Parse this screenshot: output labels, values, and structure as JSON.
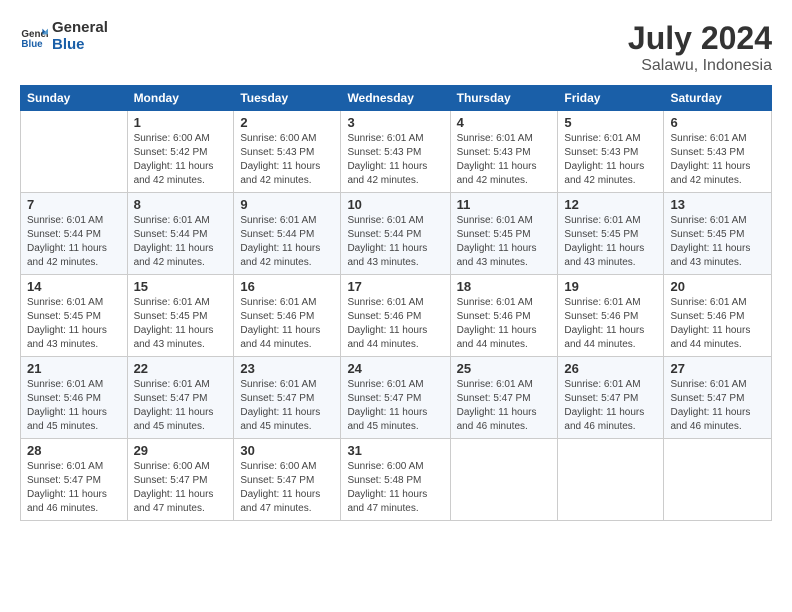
{
  "logo": {
    "line1": "General",
    "line2": "Blue"
  },
  "title": {
    "month_year": "July 2024",
    "location": "Salawu, Indonesia"
  },
  "header": {
    "days": [
      "Sunday",
      "Monday",
      "Tuesday",
      "Wednesday",
      "Thursday",
      "Friday",
      "Saturday"
    ]
  },
  "weeks": [
    [
      {
        "day": "",
        "info": ""
      },
      {
        "day": "1",
        "info": "Sunrise: 6:00 AM\nSunset: 5:42 PM\nDaylight: 11 hours\nand 42 minutes."
      },
      {
        "day": "2",
        "info": "Sunrise: 6:00 AM\nSunset: 5:43 PM\nDaylight: 11 hours\nand 42 minutes."
      },
      {
        "day": "3",
        "info": "Sunrise: 6:01 AM\nSunset: 5:43 PM\nDaylight: 11 hours\nand 42 minutes."
      },
      {
        "day": "4",
        "info": "Sunrise: 6:01 AM\nSunset: 5:43 PM\nDaylight: 11 hours\nand 42 minutes."
      },
      {
        "day": "5",
        "info": "Sunrise: 6:01 AM\nSunset: 5:43 PM\nDaylight: 11 hours\nand 42 minutes."
      },
      {
        "day": "6",
        "info": "Sunrise: 6:01 AM\nSunset: 5:43 PM\nDaylight: 11 hours\nand 42 minutes."
      }
    ],
    [
      {
        "day": "7",
        "info": "Sunrise: 6:01 AM\nSunset: 5:44 PM\nDaylight: 11 hours\nand 42 minutes."
      },
      {
        "day": "8",
        "info": "Sunrise: 6:01 AM\nSunset: 5:44 PM\nDaylight: 11 hours\nand 42 minutes."
      },
      {
        "day": "9",
        "info": "Sunrise: 6:01 AM\nSunset: 5:44 PM\nDaylight: 11 hours\nand 42 minutes."
      },
      {
        "day": "10",
        "info": "Sunrise: 6:01 AM\nSunset: 5:44 PM\nDaylight: 11 hours\nand 43 minutes."
      },
      {
        "day": "11",
        "info": "Sunrise: 6:01 AM\nSunset: 5:45 PM\nDaylight: 11 hours\nand 43 minutes."
      },
      {
        "day": "12",
        "info": "Sunrise: 6:01 AM\nSunset: 5:45 PM\nDaylight: 11 hours\nand 43 minutes."
      },
      {
        "day": "13",
        "info": "Sunrise: 6:01 AM\nSunset: 5:45 PM\nDaylight: 11 hours\nand 43 minutes."
      }
    ],
    [
      {
        "day": "14",
        "info": "Sunrise: 6:01 AM\nSunset: 5:45 PM\nDaylight: 11 hours\nand 43 minutes."
      },
      {
        "day": "15",
        "info": "Sunrise: 6:01 AM\nSunset: 5:45 PM\nDaylight: 11 hours\nand 43 minutes."
      },
      {
        "day": "16",
        "info": "Sunrise: 6:01 AM\nSunset: 5:46 PM\nDaylight: 11 hours\nand 44 minutes."
      },
      {
        "day": "17",
        "info": "Sunrise: 6:01 AM\nSunset: 5:46 PM\nDaylight: 11 hours\nand 44 minutes."
      },
      {
        "day": "18",
        "info": "Sunrise: 6:01 AM\nSunset: 5:46 PM\nDaylight: 11 hours\nand 44 minutes."
      },
      {
        "day": "19",
        "info": "Sunrise: 6:01 AM\nSunset: 5:46 PM\nDaylight: 11 hours\nand 44 minutes."
      },
      {
        "day": "20",
        "info": "Sunrise: 6:01 AM\nSunset: 5:46 PM\nDaylight: 11 hours\nand 44 minutes."
      }
    ],
    [
      {
        "day": "21",
        "info": "Sunrise: 6:01 AM\nSunset: 5:46 PM\nDaylight: 11 hours\nand 45 minutes."
      },
      {
        "day": "22",
        "info": "Sunrise: 6:01 AM\nSunset: 5:47 PM\nDaylight: 11 hours\nand 45 minutes."
      },
      {
        "day": "23",
        "info": "Sunrise: 6:01 AM\nSunset: 5:47 PM\nDaylight: 11 hours\nand 45 minutes."
      },
      {
        "day": "24",
        "info": "Sunrise: 6:01 AM\nSunset: 5:47 PM\nDaylight: 11 hours\nand 45 minutes."
      },
      {
        "day": "25",
        "info": "Sunrise: 6:01 AM\nSunset: 5:47 PM\nDaylight: 11 hours\nand 46 minutes."
      },
      {
        "day": "26",
        "info": "Sunrise: 6:01 AM\nSunset: 5:47 PM\nDaylight: 11 hours\nand 46 minutes."
      },
      {
        "day": "27",
        "info": "Sunrise: 6:01 AM\nSunset: 5:47 PM\nDaylight: 11 hours\nand 46 minutes."
      }
    ],
    [
      {
        "day": "28",
        "info": "Sunrise: 6:01 AM\nSunset: 5:47 PM\nDaylight: 11 hours\nand 46 minutes."
      },
      {
        "day": "29",
        "info": "Sunrise: 6:00 AM\nSunset: 5:47 PM\nDaylight: 11 hours\nand 47 minutes."
      },
      {
        "day": "30",
        "info": "Sunrise: 6:00 AM\nSunset: 5:47 PM\nDaylight: 11 hours\nand 47 minutes."
      },
      {
        "day": "31",
        "info": "Sunrise: 6:00 AM\nSunset: 5:48 PM\nDaylight: 11 hours\nand 47 minutes."
      },
      {
        "day": "",
        "info": ""
      },
      {
        "day": "",
        "info": ""
      },
      {
        "day": "",
        "info": ""
      }
    ]
  ]
}
